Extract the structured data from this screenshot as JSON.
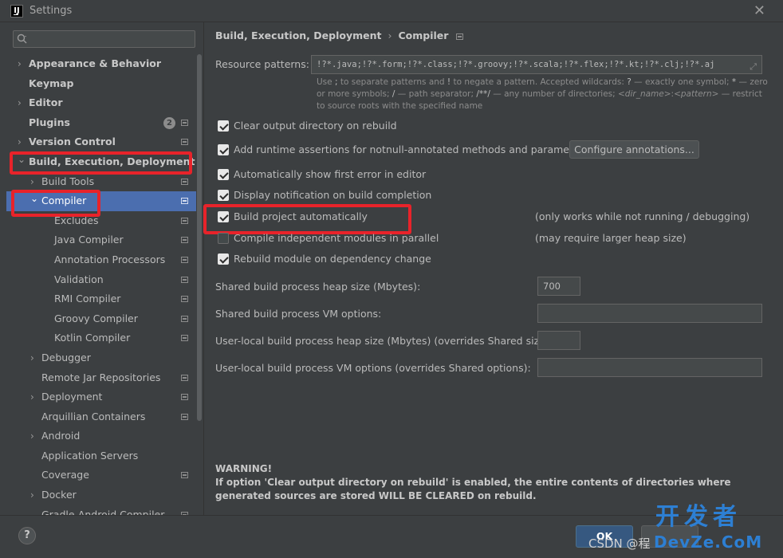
{
  "window": {
    "title": "Settings",
    "app_icon": "IJ"
  },
  "sidebar": {
    "search_placeholder": "",
    "items": [
      {
        "label": "Appearance & Behavior",
        "level": 0,
        "arrow": "›",
        "bold": true
      },
      {
        "label": "Keymap",
        "level": 0,
        "arrow": "",
        "bold": true
      },
      {
        "label": "Editor",
        "level": 0,
        "arrow": "›",
        "bold": true
      },
      {
        "label": "Plugins",
        "level": 0,
        "arrow": "",
        "bold": true,
        "badge": "2",
        "project_icon": true
      },
      {
        "label": "Version Control",
        "level": 0,
        "arrow": "›",
        "bold": true,
        "project_icon": true
      },
      {
        "label": "Build, Execution, Deployment",
        "level": 0,
        "arrow": "⌄",
        "bold": true
      },
      {
        "label": "Build Tools",
        "level": 1,
        "arrow": "›",
        "project_icon": true
      },
      {
        "label": "Compiler",
        "level": 1,
        "arrow": "⌄",
        "selected": true,
        "project_icon": true
      },
      {
        "label": "Excludes",
        "level": 2,
        "arrow": "",
        "project_icon": true
      },
      {
        "label": "Java Compiler",
        "level": 2,
        "arrow": "",
        "project_icon": true
      },
      {
        "label": "Annotation Processors",
        "level": 2,
        "arrow": "",
        "project_icon": true
      },
      {
        "label": "Validation",
        "level": 2,
        "arrow": "",
        "project_icon": true
      },
      {
        "label": "RMI Compiler",
        "level": 2,
        "arrow": "",
        "project_icon": true
      },
      {
        "label": "Groovy Compiler",
        "level": 2,
        "arrow": "",
        "project_icon": true
      },
      {
        "label": "Kotlin Compiler",
        "level": 2,
        "arrow": "",
        "project_icon": true
      },
      {
        "label": "Debugger",
        "level": 1,
        "arrow": "›"
      },
      {
        "label": "Remote Jar Repositories",
        "level": 1,
        "arrow": "",
        "project_icon": true
      },
      {
        "label": "Deployment",
        "level": 1,
        "arrow": "›",
        "project_icon": true
      },
      {
        "label": "Arquillian Containers",
        "level": 1,
        "arrow": "",
        "project_icon": true
      },
      {
        "label": "Android",
        "level": 1,
        "arrow": "›"
      },
      {
        "label": "Application Servers",
        "level": 1,
        "arrow": ""
      },
      {
        "label": "Coverage",
        "level": 1,
        "arrow": "",
        "project_icon": true
      },
      {
        "label": "Docker",
        "level": 1,
        "arrow": "›"
      },
      {
        "label": "Gradle-Android Compiler",
        "level": 1,
        "arrow": "",
        "project_icon": true
      }
    ]
  },
  "breadcrumb": {
    "parent": "Build, Execution, Deployment",
    "separator": "›",
    "current": "Compiler"
  },
  "resource": {
    "label": "Resource patterns:",
    "value": "!?*.java;!?*.form;!?*.class;!?*.groovy;!?*.scala;!?*.flex;!?*.kt;!?*.clj;!?*.aj",
    "hint_parts": {
      "p1": "Use ",
      "semi": ";",
      "p2": " to separate patterns and ",
      "bang": "!",
      "p3": " to negate a pattern. Accepted wildcards: ",
      "q": "?",
      "p4": " — exactly one symbol; ",
      "star": "*",
      "p5": " — zero or more symbols; ",
      "slash": "/",
      "p6": " — path separator; ",
      "dstar": "/**/",
      "p7": " — any number of directories; ",
      "dirname": "<dir_name>",
      "colon": ":",
      "pattern": "<pattern>",
      "p8": " — restrict to source roots with the specified name"
    }
  },
  "options": [
    {
      "label": "Clear output directory on rebuild",
      "checked": true
    },
    {
      "label": "Add runtime assertions for notnull-annotated methods and parameters",
      "checked": true
    },
    {
      "label": "Automatically show first error in editor",
      "checked": true
    },
    {
      "label": "Display notification on build completion",
      "checked": true
    },
    {
      "label": "Build project automatically",
      "checked": true,
      "note": "(only works while not running / debugging)"
    },
    {
      "label": "Compile independent modules in parallel",
      "checked": false,
      "note": "(may require larger heap size)"
    },
    {
      "label": "Rebuild module on dependency change",
      "checked": true
    }
  ],
  "configure_button": "Configure annotations...",
  "fields": [
    {
      "label": "Shared build process heap size (Mbytes):",
      "value": "700"
    },
    {
      "label": "Shared build process VM options:",
      "value": ""
    },
    {
      "label": "User-local build process heap size (Mbytes) (overrides Shared size):",
      "value": ""
    },
    {
      "label": "User-local build process VM options (overrides Shared options):",
      "value": ""
    }
  ],
  "warning": {
    "title": "WARNING!",
    "text": "If option 'Clear output directory on rebuild' is enabled, the entire contents of directories where generated sources are stored WILL BE CLEARED on rebuild."
  },
  "footer": {
    "help": "?",
    "ok": "OK",
    "cancel": ""
  },
  "watermark": {
    "csdn": "CSDN @程",
    "brand": "开发者",
    "url": "DevZe.CoM"
  },
  "colors": {
    "annotation_red": "#e8232a",
    "selection": "#4b6eaf",
    "background": "#3c3f41"
  }
}
